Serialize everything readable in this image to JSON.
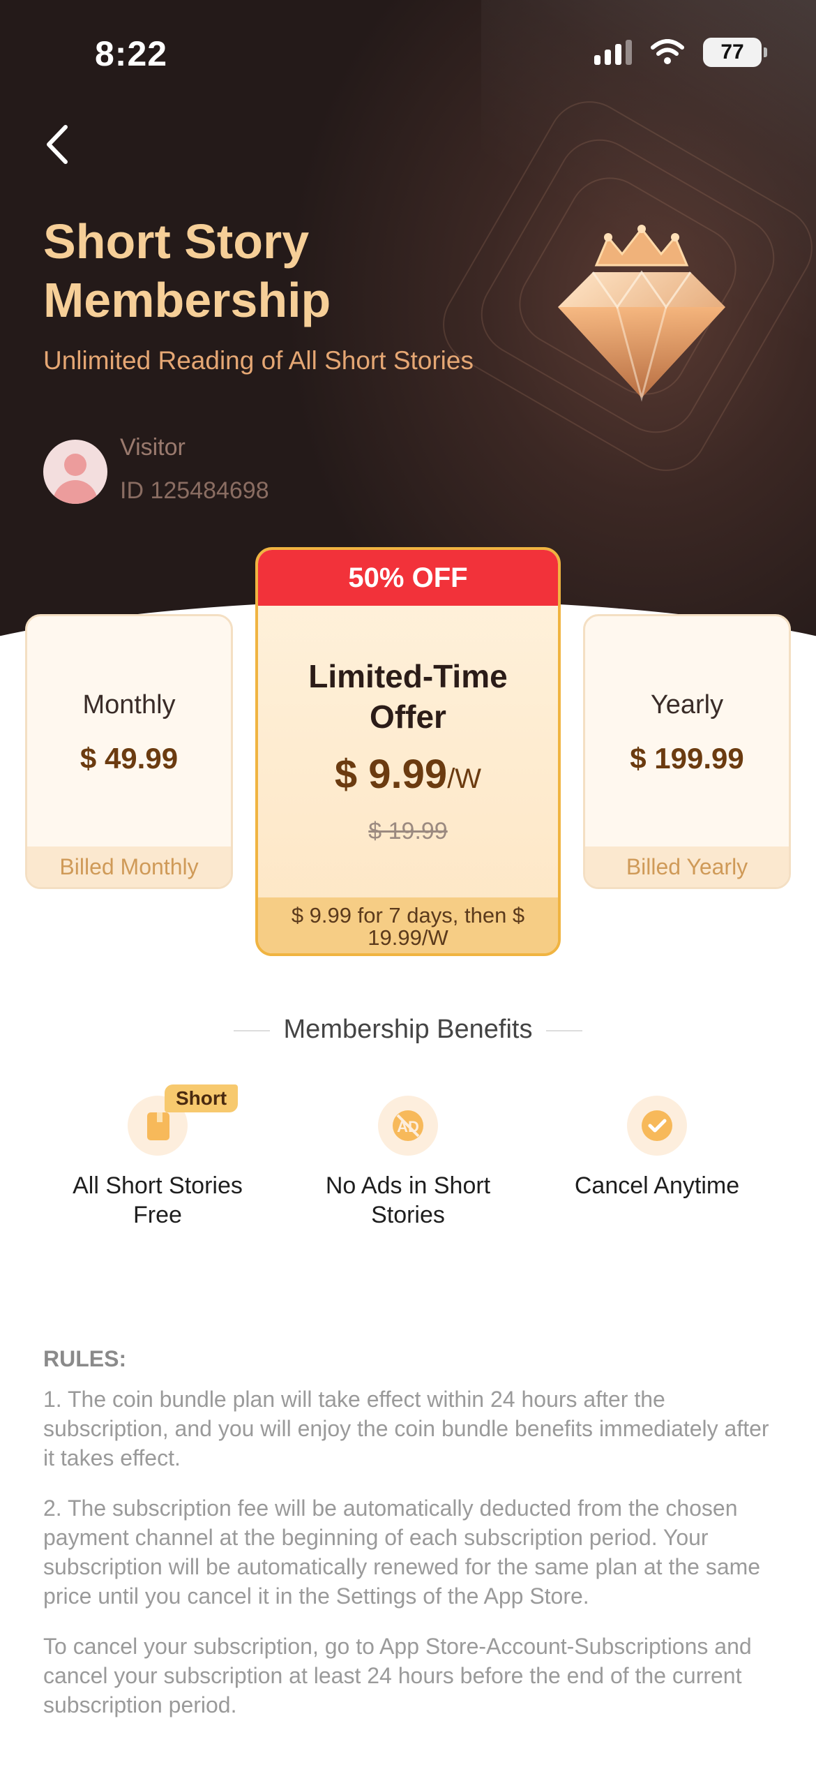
{
  "status": {
    "time": "8:22",
    "battery": "77"
  },
  "header": {
    "title": "Short Story Membership",
    "subtitle": "Unlimited Reading of All Short Stories"
  },
  "user": {
    "name": "Visitor",
    "id": "ID 125484698"
  },
  "plans": {
    "monthly": {
      "name": "Monthly",
      "price": "$ 49.99",
      "billing": "Billed Monthly"
    },
    "offer": {
      "badge": "50% OFF",
      "name": "Limited-Time Offer",
      "price": "$ 9.99",
      "unit": "/W",
      "original_price": "$ 19.99",
      "note": "$ 9.99 for 7 days, then $ 19.99/W"
    },
    "yearly": {
      "name": "Yearly",
      "price": "$ 199.99",
      "billing": "Billed Yearly"
    }
  },
  "benefits": {
    "title": "Membership Benefits",
    "short_tag": "Short",
    "items": [
      {
        "label": "All Short Stories Free",
        "icon": "book-icon"
      },
      {
        "label": "No Ads in Short Stories",
        "icon": "no-ads-icon"
      },
      {
        "label": "Cancel Anytime",
        "icon": "check-icon"
      }
    ]
  },
  "rules": {
    "heading": "RULES:",
    "items": [
      "1. The coin bundle plan will take effect within 24 hours after the subscription, and you will enjoy the coin bundle benefits immediately after it takes effect.",
      "2. The subscription fee will be automatically deducted from the chosen payment channel at the beginning of each subscription period. Your subscription will be automatically renewed for the same plan at the same price until you cancel it in the Settings of the App Store.",
      "To cancel your subscription, go to App Store-Account-Subscriptions and cancel your subscription at least 24 hours before the end of the current subscription period."
    ]
  },
  "colors": {
    "accent_gold": "#f6cf98",
    "badge_red": "#f2323a",
    "offer_border": "#f0b441"
  }
}
